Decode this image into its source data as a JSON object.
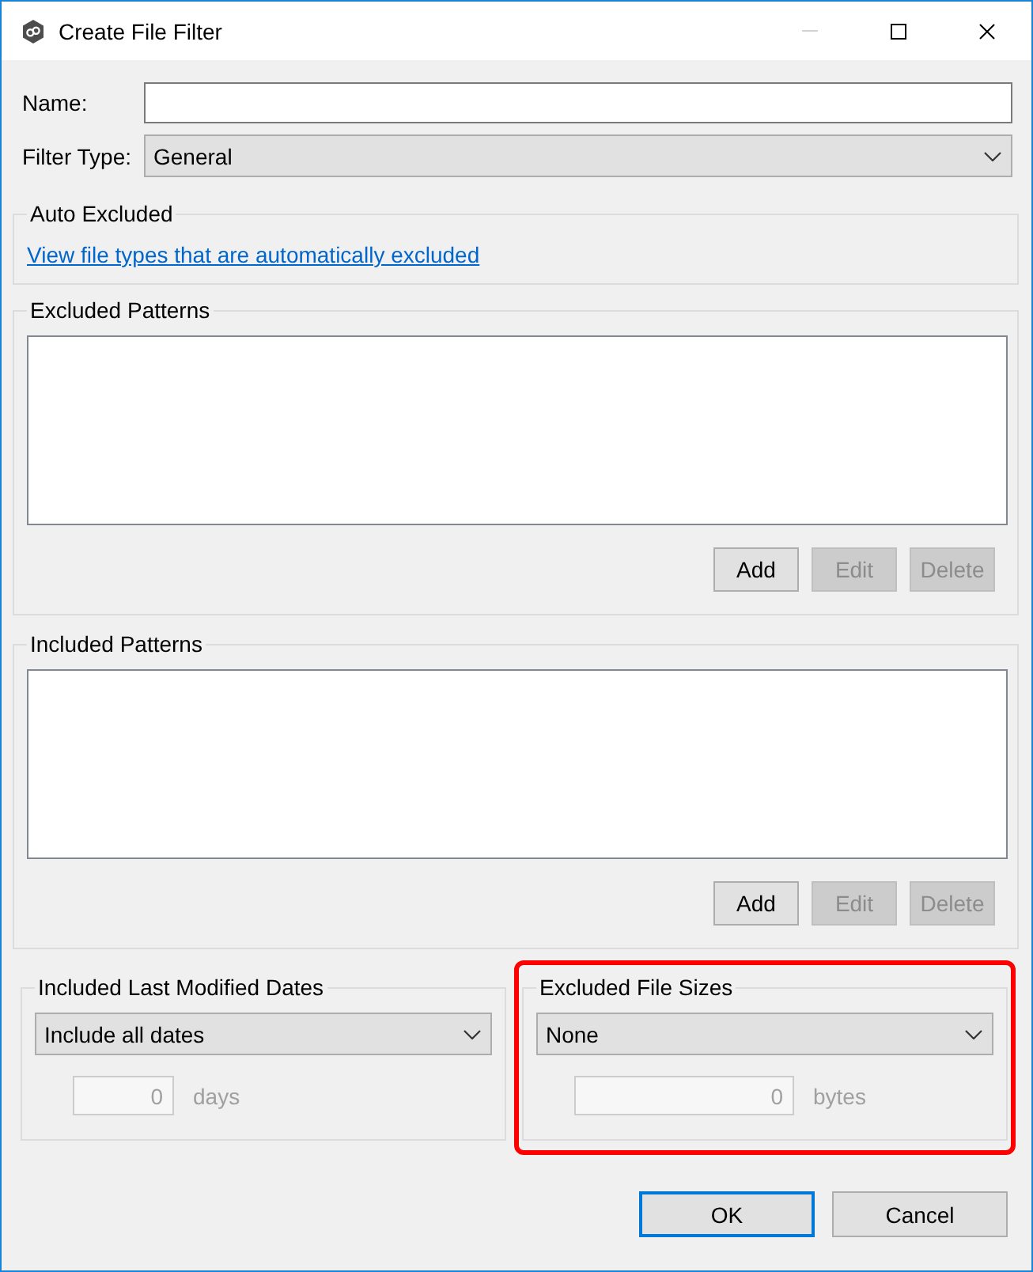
{
  "window": {
    "title": "Create File Filter",
    "controls": [
      {
        "kind": "minimize",
        "disabled": true
      },
      {
        "kind": "maximize",
        "disabled": false
      },
      {
        "kind": "close",
        "disabled": false
      }
    ]
  },
  "name_field": {
    "label": "Name:"
  },
  "filter_type": {
    "label": "Filter Type:",
    "value": "General"
  },
  "auto_excluded": {
    "title": "Auto Excluded",
    "link": "View file types that are automatically excluded"
  },
  "pattern_groups": [
    {
      "title": "Excluded Patterns",
      "buttons": [
        {
          "label": "Add",
          "disabled": false
        },
        {
          "label": "Edit",
          "disabled": true
        },
        {
          "label": "Delete",
          "disabled": true
        }
      ]
    },
    {
      "title": "Included Patterns",
      "buttons": [
        {
          "label": "Add",
          "disabled": false
        },
        {
          "label": "Edit",
          "disabled": true
        },
        {
          "label": "Delete",
          "disabled": true
        }
      ]
    }
  ],
  "option_groups": [
    {
      "title": "Included Last Modified Dates",
      "highlighted": false,
      "value": "Include all dates",
      "amount": {
        "value": "0",
        "unit": "days",
        "disabled": true
      }
    },
    {
      "title": "Excluded File Sizes",
      "highlighted": true,
      "value": "None",
      "amount": {
        "value": "0",
        "unit": "bytes",
        "disabled": true
      }
    }
  ],
  "buttons": [
    {
      "label": "OK",
      "default": true
    },
    {
      "label": "Cancel",
      "default": false
    }
  ]
}
